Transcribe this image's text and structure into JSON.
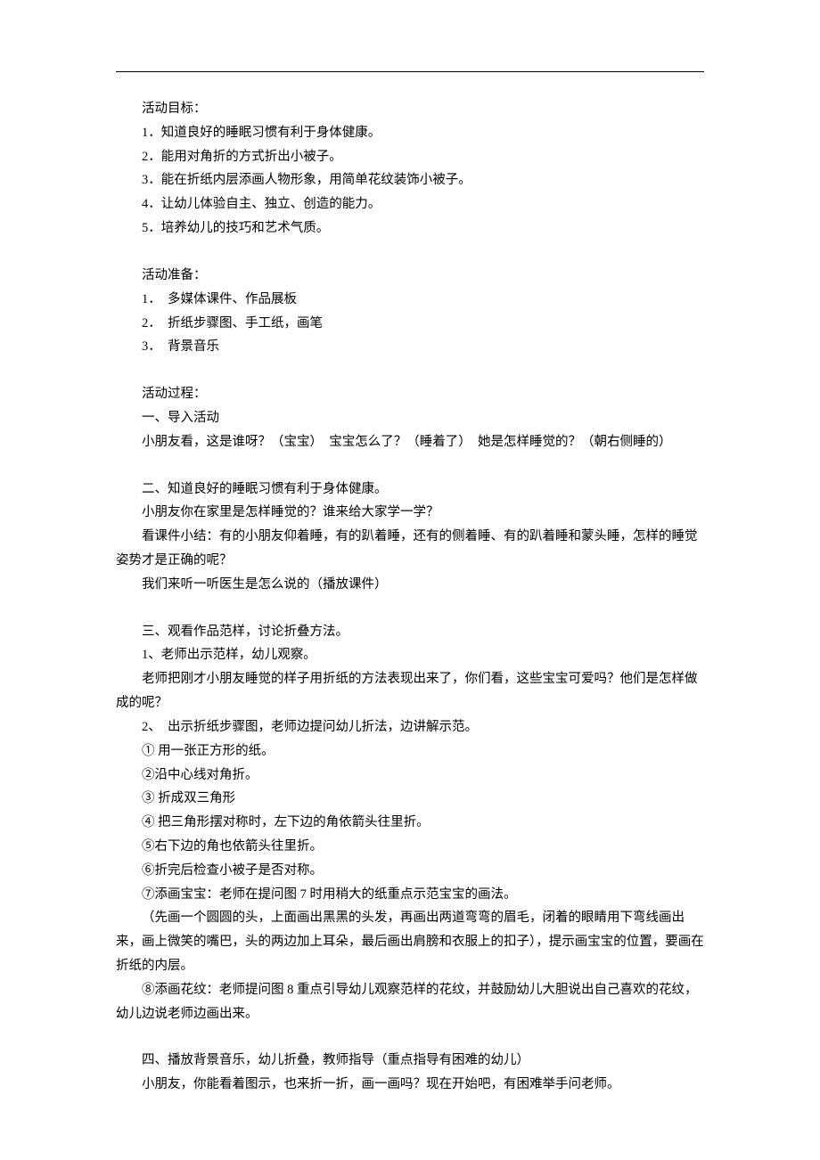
{
  "sections": {
    "objectives": {
      "title": "活动目标：",
      "items": [
        "1．知道良好的睡眠习惯有利于身体健康。",
        "2．能用对角折的方式折出小被子。",
        "3．能在折纸内层添画人物形象，用简单花纹装饰小被子。",
        "4．让幼儿体验自主、独立、创造的能力。",
        "5．培养幼儿的技巧和艺术气质。"
      ]
    },
    "preparation": {
      "title": "活动准备：",
      "items": [
        "1．　多媒体课件、作品展板",
        "2．　折纸步骤图、手工纸，画笔",
        "3．　背景音乐"
      ]
    },
    "process": {
      "title": "活动过程：",
      "part1": {
        "heading": "一、导入活动",
        "line1": "小朋友看，这是谁呀？（宝宝）　宝宝怎么了？（睡着了）　她是怎样睡觉的？（朝右侧睡的）"
      },
      "part2": {
        "heading": "二、知道良好的睡眠习惯有利于身体健康。",
        "line1": "小朋友你在家里是怎样睡觉的？谁来给大家学一学？",
        "line2": "看课件小结：有的小朋友仰着睡，有的趴着睡，还有的侧着睡、有的趴着睡和蒙头睡，怎样的睡觉姿势才是正确的呢？",
        "line3": "我们来听一听医生是怎么说的（播放课件）"
      },
      "part3": {
        "heading": "三、观看作品范样，讨论折叠方法。",
        "sub1": "1、老师出示范样，幼儿观察。",
        "line1": "老师把刚才小朋友睡觉的样子用折纸的方法表现出来了，你们看，这些宝宝可爱吗？他们是怎样做成的呢？",
        "sub2": "2、　出示折纸步骤图，老师边提问幼儿折法，边讲解示范。",
        "step1": "① 用一张正方形的纸。",
        "step2": "②沿中心线对角折。",
        "step3": "③ 折成双三角形",
        "step4": "④ 把三角形摆对称时，左下边的角依箭头往里折。",
        "step5": "⑤右下边的角也依箭头往里折。",
        "step6": "⑥折完后检查小被子是否对称。",
        "step7": "⑦添画宝宝：老师在提问图 7 时用稍大的纸重点示范宝宝的画法。",
        "step7b": "（先画一个圆圆的头，上面画出黑黑的头发，再画出两道弯弯的眉毛，闭着的眼睛用下弯线画出来，画上微笑的嘴巴，头的两边加上耳朵，最后画出肩膀和衣服上的扣子），提示画宝宝的位置，要画在折纸的内层。",
        "step8": "⑧添画花纹：老师提问图 8 重点引导幼儿观察范样的花纹，并鼓励幼儿大胆说出自己喜欢的花纹，幼儿边说老师边画出来。"
      },
      "part4": {
        "heading": "四、播放背景音乐，幼儿折叠，教师指导（重点指导有困难的幼儿）",
        "line1": "小朋友，你能看着图示，也来折一折，画一画吗？现在开始吧，有困难举手问老师。"
      }
    }
  }
}
